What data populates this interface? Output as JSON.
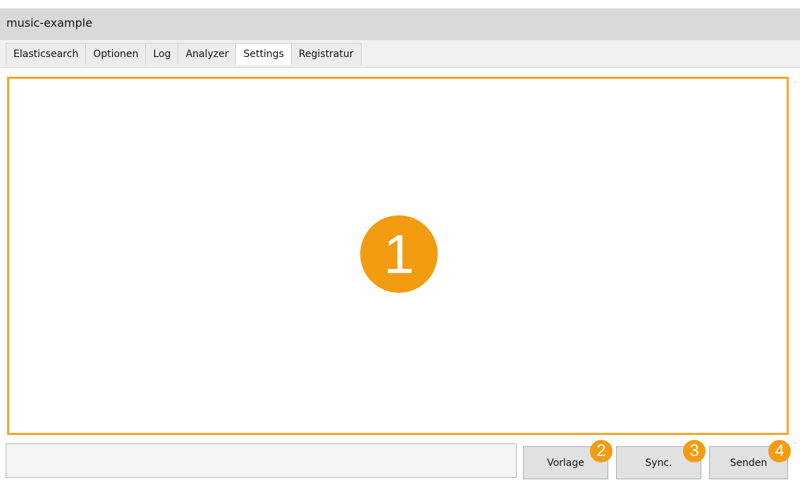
{
  "window": {
    "title": "music-example"
  },
  "tabs": [
    {
      "label": "Elasticsearch",
      "active": false
    },
    {
      "label": "Optionen",
      "active": false
    },
    {
      "label": "Log",
      "active": false
    },
    {
      "label": "Analyzer",
      "active": false
    },
    {
      "label": "Settings",
      "active": true
    },
    {
      "label": "Registratur",
      "active": false
    }
  ],
  "editor": {
    "callout": "1",
    "highlight_color": "#f5a623"
  },
  "status": {
    "value": ""
  },
  "buttons": {
    "vorlage": {
      "label": "Vorlage",
      "callout": "2"
    },
    "sync": {
      "label": "Sync.",
      "callout": "3"
    },
    "senden": {
      "label": "Senden",
      "callout": "4"
    }
  },
  "colors": {
    "callout": "#f39c12",
    "titlebar": "#d9d9d9"
  }
}
